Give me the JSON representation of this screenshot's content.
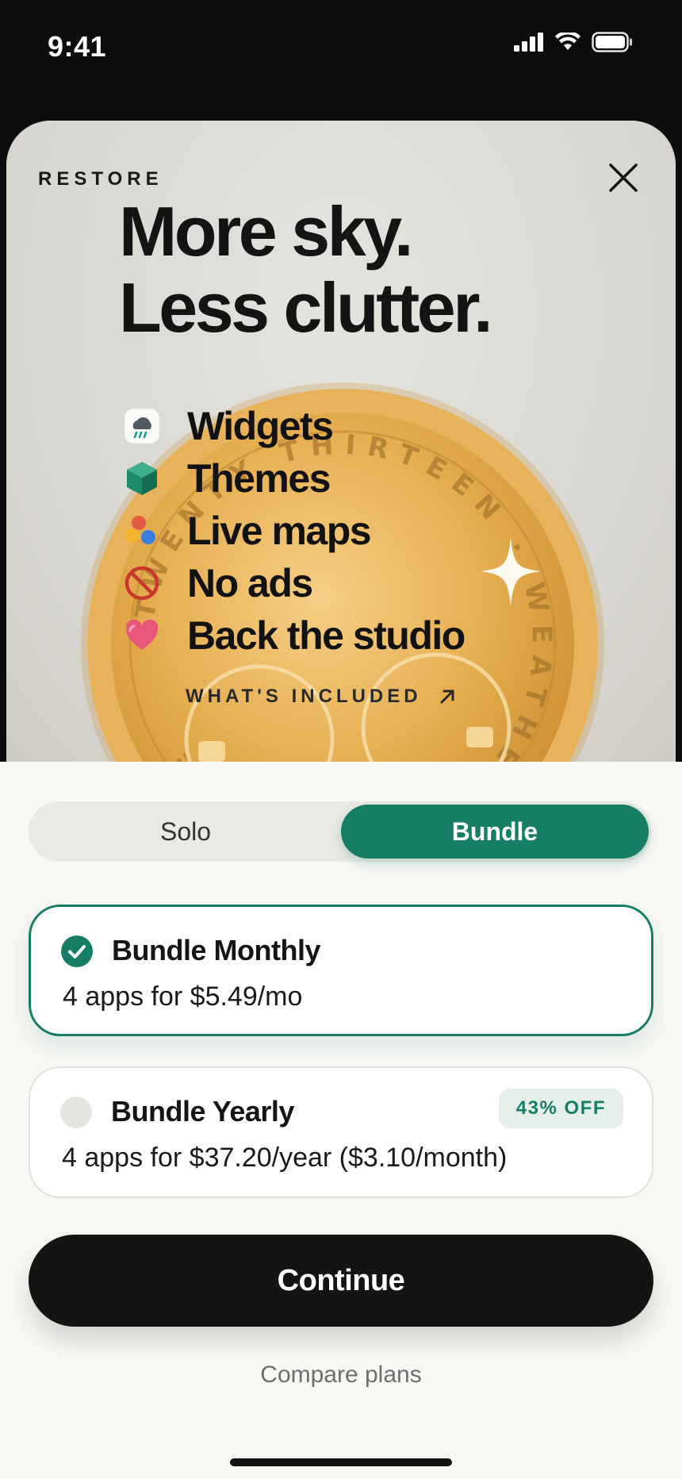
{
  "status_bar": {
    "time": "9:41"
  },
  "hero": {
    "restore_label": "RESTORE",
    "headline_line1": "More sky.",
    "headline_line2": "Less clutter.",
    "features": [
      {
        "label": "Widgets",
        "icon": "rain-cloud-icon"
      },
      {
        "label": "Themes",
        "icon": "cube-icon"
      },
      {
        "label": "Live maps",
        "icon": "color-dots-icon"
      },
      {
        "label": "No ads",
        "icon": "no-ads-icon"
      },
      {
        "label": "Back the studio",
        "icon": "heart-icon"
      }
    ],
    "whats_included_label": "WHAT'S INCLUDED",
    "coin_inscription": "TWENTY THIRTEEN • WEATHERWICK • ISSUE"
  },
  "plan_toggle": {
    "options": [
      "Solo",
      "Bundle"
    ],
    "selected": "Bundle"
  },
  "plans": [
    {
      "title": "Bundle Monthly",
      "price": "4 apps for $5.49/mo",
      "selected": true
    },
    {
      "title": "Bundle Yearly",
      "price": "4 apps for $37.20/year ($3.10/month)",
      "badge": "43% OFF",
      "selected": false
    }
  ],
  "continue_label": "Continue",
  "compare_label": "Compare plans",
  "colors": {
    "accent": "#167e66",
    "coin_gold": "#e3aa4e",
    "button_dark": "#141412",
    "hero_bg": "#dedcd6"
  }
}
